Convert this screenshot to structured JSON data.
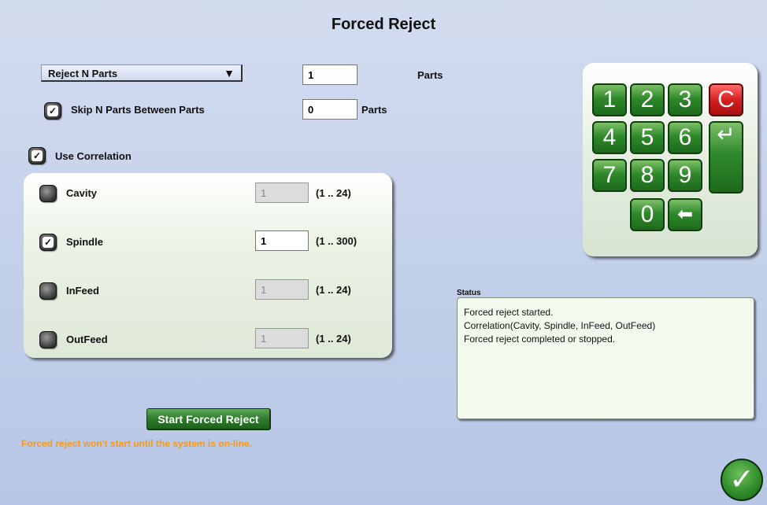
{
  "title": "Forced Reject",
  "mode_select": {
    "value": "Reject N Parts",
    "arrow": "▼"
  },
  "reject_n": {
    "value": "1",
    "unit": "Parts"
  },
  "skip": {
    "checked": true,
    "label": "Skip N Parts Between Parts",
    "value": "0",
    "unit": "Parts"
  },
  "use_correlation": {
    "checked": true,
    "label": "Use Correlation"
  },
  "correlation": [
    {
      "label": "Cavity",
      "checked": false,
      "value": "1",
      "range": "(1 .. 24)",
      "enabled": false
    },
    {
      "label": "Spindle",
      "checked": true,
      "value": "1",
      "range": "(1 .. 300)",
      "enabled": true
    },
    {
      "label": "InFeed",
      "checked": false,
      "value": "1",
      "range": "(1 .. 24)",
      "enabled": false
    },
    {
      "label": "OutFeed",
      "checked": false,
      "value": "1",
      "range": "(1 .. 24)",
      "enabled": false
    }
  ],
  "keypad": {
    "k1": "1",
    "k2": "2",
    "k3": "3",
    "clear": "C",
    "k4": "4",
    "k5": "5",
    "k6": "6",
    "enter": "↵",
    "k7": "7",
    "k8": "8",
    "k9": "9",
    "k0": "0",
    "backspace": "⬅"
  },
  "status": {
    "title": "Status",
    "lines": [
      "Forced reject started.",
      "Correlation(Cavity, Spindle, InFeed, OutFeed)",
      "Forced reject completed or stopped."
    ]
  },
  "start_button": "Start Forced Reject",
  "warning": "Forced reject won't start until the system is on-line.",
  "ok_icon": "✓",
  "checkmark": "✓",
  "colors": {
    "warning": "#f49a1e",
    "key_green": "#2f8a2c",
    "key_red": "#d42020",
    "status_bg": "#f2fbee"
  }
}
